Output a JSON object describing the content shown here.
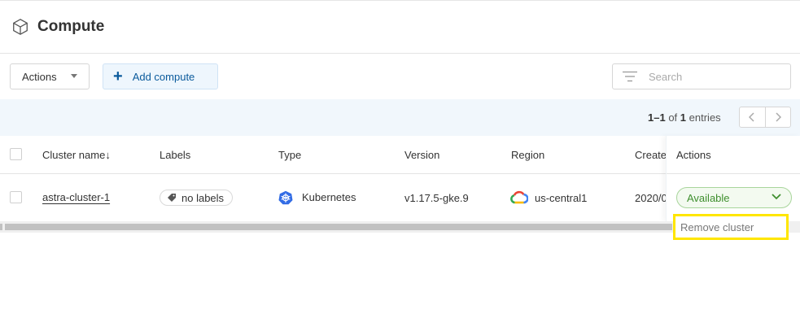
{
  "page": {
    "title": "Compute",
    "icon": "cube-icon"
  },
  "toolbar": {
    "actions_label": "Actions",
    "add_label": "Add compute",
    "search_placeholder": "Search"
  },
  "pager": {
    "range": "1–1",
    "of_text": "of",
    "total": "1",
    "entries_text": "entries"
  },
  "table": {
    "columns": [
      "Cluster name",
      "Labels",
      "Type",
      "Version",
      "Region",
      "Create",
      "Actions"
    ],
    "sort_indicator": "↓",
    "rows": [
      {
        "cluster_name": "astra-cluster-1",
        "labels": "no labels",
        "type": "Kubernetes",
        "version": "v1.17.5-gke.9",
        "region": "us-central1",
        "created": "2020/0",
        "status": "Available"
      }
    ]
  },
  "dropdown_menu": {
    "items": [
      "Remove cluster"
    ]
  },
  "colors": {
    "accent": "#0a5a9c",
    "status_green": "#3f8f2e",
    "highlight": "#ffe600",
    "pager_bg": "#f1f7fc"
  }
}
